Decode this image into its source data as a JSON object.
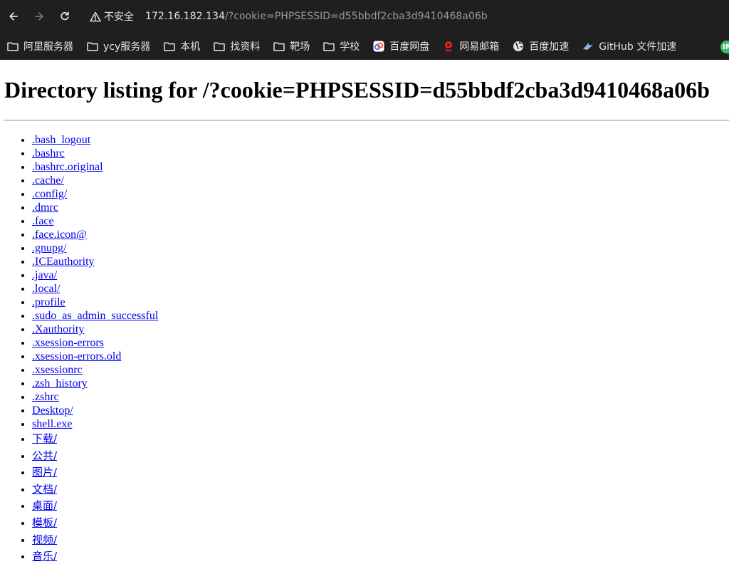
{
  "browser": {
    "security_label": "不安全",
    "url_host": "172.16.182.134",
    "url_path": "/?cookie=PHPSESSID=d55bbdf2cba3d9410468a06b",
    "back_icon": "arrow-left-icon",
    "forward_icon": "arrow-right-icon",
    "reload_icon": "reload-icon",
    "security_icon": "warning-triangle-icon"
  },
  "bookmarks": [
    {
      "label": "阿里服务器",
      "icon": "folder-icon"
    },
    {
      "label": "ycy服务器",
      "icon": "folder-icon"
    },
    {
      "label": "本机",
      "icon": "folder-icon"
    },
    {
      "label": "找资料",
      "icon": "folder-icon"
    },
    {
      "label": "靶场",
      "icon": "folder-icon"
    },
    {
      "label": "学校",
      "icon": "folder-icon"
    },
    {
      "label": "百度网盘",
      "icon": "baidu-netdisk-icon"
    },
    {
      "label": "网易邮箱",
      "icon": "netease-mail-icon"
    },
    {
      "label": "百度加速",
      "icon": "globe-icon"
    },
    {
      "label": "GitHub 文件加速",
      "icon": "github-accel-icon"
    }
  ],
  "page": {
    "title": "Directory listing for /?cookie=PHPSESSID=d55bbdf2cba3d9410468a06b",
    "entries": [
      ".bash_logout",
      ".bashrc",
      ".bashrc.original",
      ".cache/",
      ".config/",
      ".dmrc",
      ".face",
      ".face.icon@",
      ".gnupg/",
      ".ICEauthority",
      ".java/",
      ".local/",
      ".profile",
      ".sudo_as_admin_successful",
      ".Xauthority",
      ".xsession-errors",
      ".xsession-errors.old",
      ".xsessionrc",
      ".zsh_history",
      ".zshrc",
      "Desktop/",
      "shell.exe",
      "下载/",
      "公共/",
      "图片/",
      "文档/",
      "桌面/",
      "模板/",
      "视频/",
      "音乐/"
    ]
  },
  "colors": {
    "chrome_bg": "#1f1f1f",
    "chrome_text": "#e3e3e3",
    "url_path_text": "#9a9a9a",
    "link": "#0000ee",
    "rule": "#c8c8c8"
  }
}
